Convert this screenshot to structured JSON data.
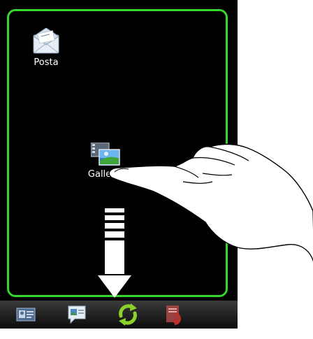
{
  "apps": [
    {
      "label": "Posta",
      "icon": "mail-envelope-icon"
    },
    {
      "label": "Galleria",
      "icon": "gallery-photo-icon"
    }
  ],
  "dock": {
    "items": [
      {
        "icon": "contacts-card-icon"
      },
      {
        "icon": "messages-bubble-icon"
      },
      {
        "icon": "rotate-arrows-icon"
      },
      {
        "icon": "document-return-icon"
      }
    ]
  },
  "colors": {
    "frame_highlight": "#35d62a",
    "background": "#000000",
    "rotate_icon": "#8bd12a"
  }
}
